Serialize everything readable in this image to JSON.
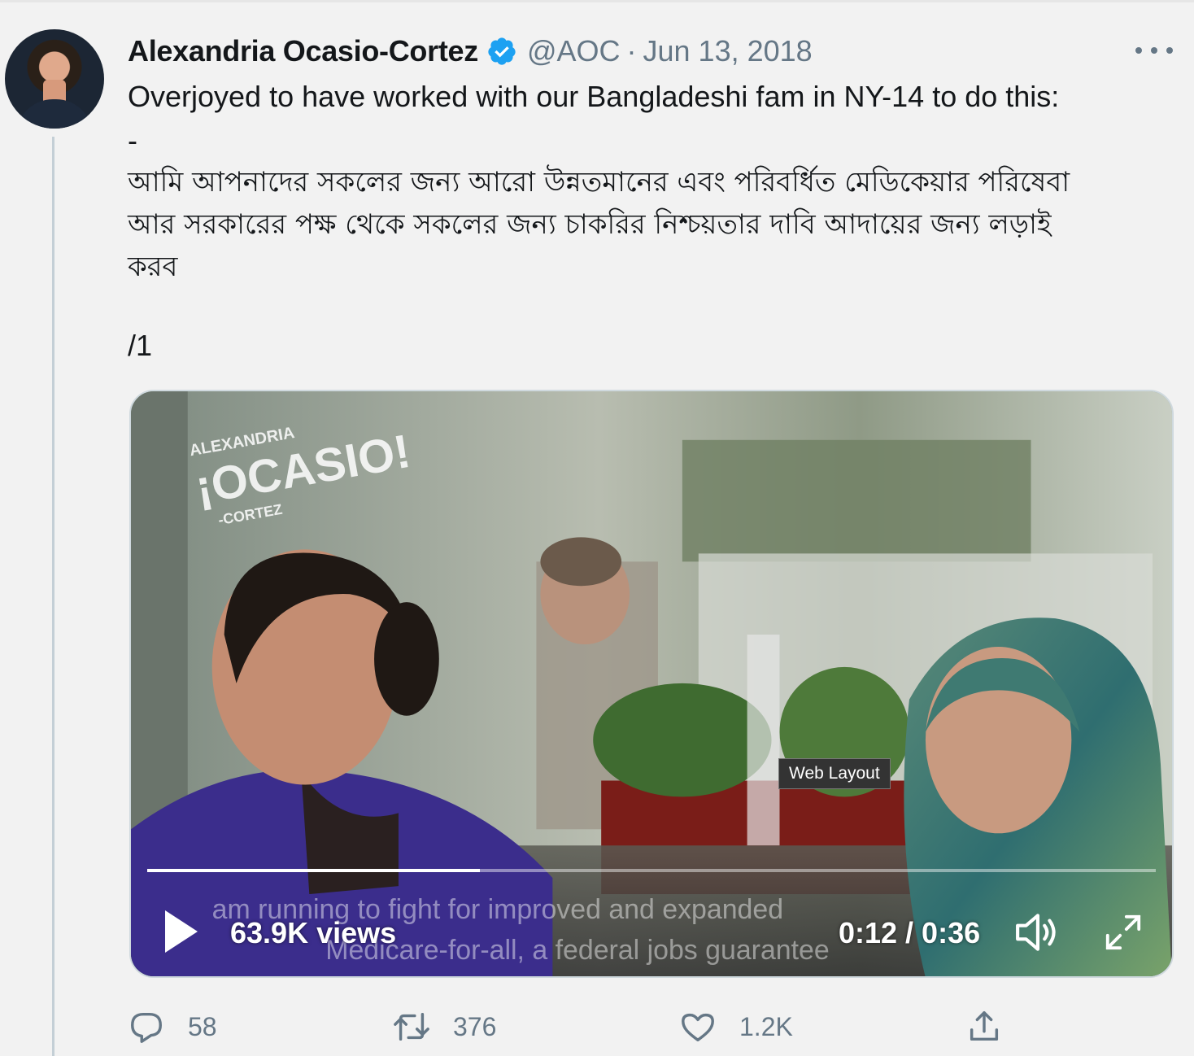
{
  "tweet": {
    "author_name": "Alexandria Ocasio-Cortez",
    "handle": "@AOC",
    "separator": "·",
    "date": "Jun 13, 2018",
    "text_line1": "Overjoyed to have worked with our Bangladeshi fam in NY-14 to do this:",
    "text_line2": "-",
    "bengali_line1": "আমি আপনাদের সকলের জন্য আরো উন্নতমানের এবং পরিবর্ধিত মেডিকেয়ার পরিষেবা",
    "bengali_line2": "আর সরকারের পক্ষ থেকে সকলের জন্য চাকরির নিশ্চয়তার দাবি আদায়ের জন্য লড়াই",
    "bengali_line3": "করব",
    "thread_marker": "/1"
  },
  "video": {
    "views": "63.9K views",
    "time": "0:12 / 0:36",
    "progress": 0.33,
    "tooltip": "Web Layout",
    "icons": [
      "play-icon",
      "volume-icon",
      "fullscreen-icon"
    ]
  },
  "actions": {
    "reply_count": "58",
    "retweet_count": "376",
    "like_count": "1.2K"
  },
  "colors": {
    "verified": "#1da1f2",
    "secondary_text": "#657786",
    "background": "#f2f2f2"
  }
}
